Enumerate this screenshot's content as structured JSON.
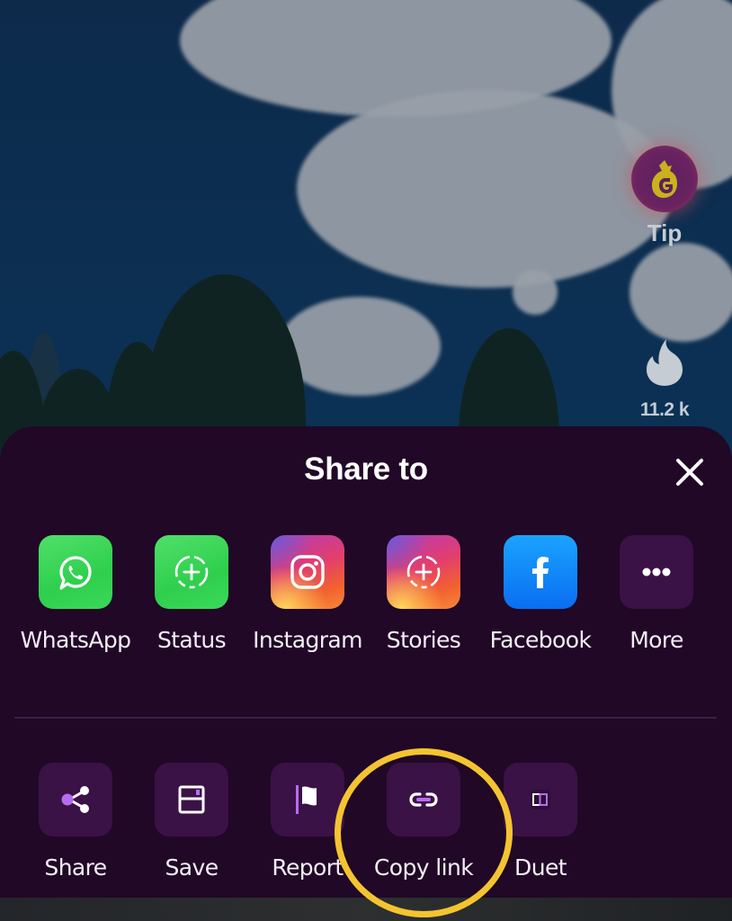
{
  "video": {
    "tip": {
      "label": "Tip",
      "icon": "dragon-coin-icon"
    },
    "likes": {
      "count": "11.2 k",
      "icon": "flame-icon"
    }
  },
  "share_sheet": {
    "title": "Share to",
    "close_icon": "close-icon",
    "apps": [
      {
        "label": "WhatsApp",
        "icon": "whatsapp-icon"
      },
      {
        "label": "Status",
        "icon": "status-add-icon"
      },
      {
        "label": "Instagram",
        "icon": "instagram-icon"
      },
      {
        "label": "Stories",
        "icon": "stories-add-icon"
      },
      {
        "label": "Facebook",
        "icon": "facebook-icon"
      },
      {
        "label": "More",
        "icon": "more-dots-icon"
      }
    ],
    "actions": [
      {
        "label": "Share",
        "icon": "share-icon"
      },
      {
        "label": "Save",
        "icon": "save-icon"
      },
      {
        "label": "Report",
        "icon": "flag-icon"
      },
      {
        "label": "Copy link",
        "icon": "link-icon",
        "highlighted": true
      },
      {
        "label": "Duet",
        "icon": "duet-icon"
      }
    ]
  },
  "colors": {
    "sheet_background": "#200826",
    "tile_purple": "#3a1245",
    "accent_purple": "#b86cf0",
    "highlight_ring": "#f4c430",
    "whatsapp_green": "#3bd85a",
    "facebook_blue": "#0a6ef2"
  }
}
